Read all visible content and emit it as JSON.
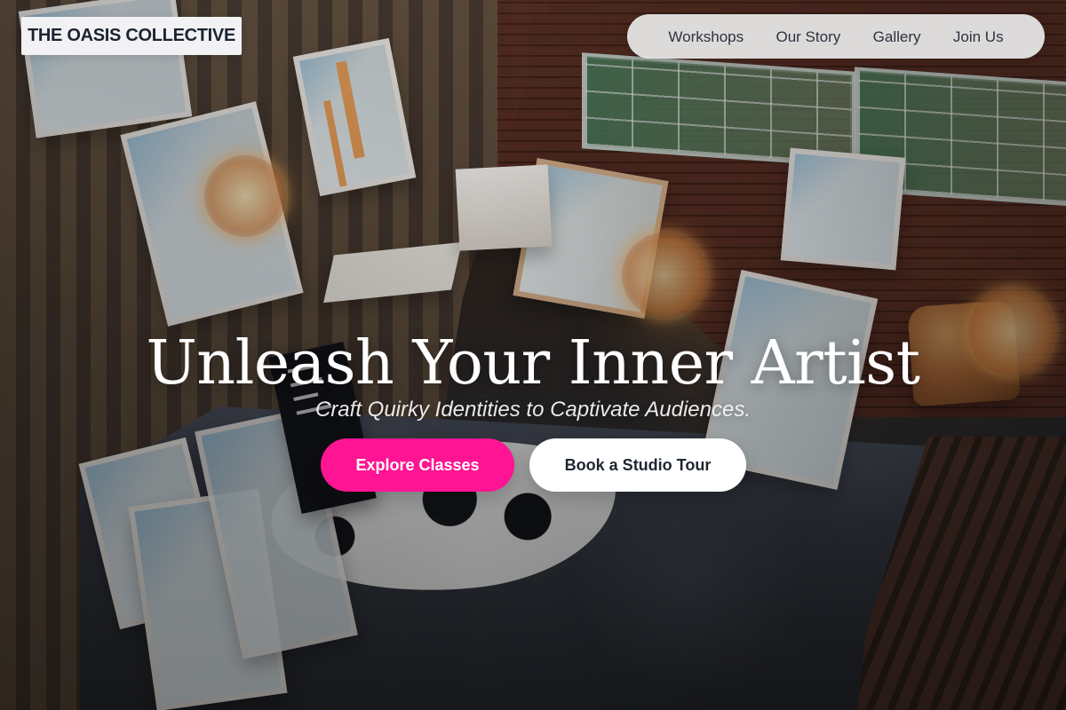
{
  "header": {
    "brand": "THE OASIS COLLECTIVE",
    "nav": [
      {
        "label": "Workshops"
      },
      {
        "label": "Our Story"
      },
      {
        "label": "Gallery"
      },
      {
        "label": "Join Us"
      }
    ]
  },
  "hero": {
    "title": "Unleash Your Inner Artist",
    "subtitle": "Craft Quirky Identities to Captivate Audiences.",
    "buttons": {
      "primary": "Explore Classes",
      "secondary": "Book a Studio Tour"
    }
  },
  "colors": {
    "brand_background": "#f2f2f4",
    "nav_background": "#eaeaea",
    "primary_button": "#ff1493",
    "secondary_button": "#ffffff",
    "text_dark": "#1e2631",
    "text_light": "#ffffff"
  }
}
